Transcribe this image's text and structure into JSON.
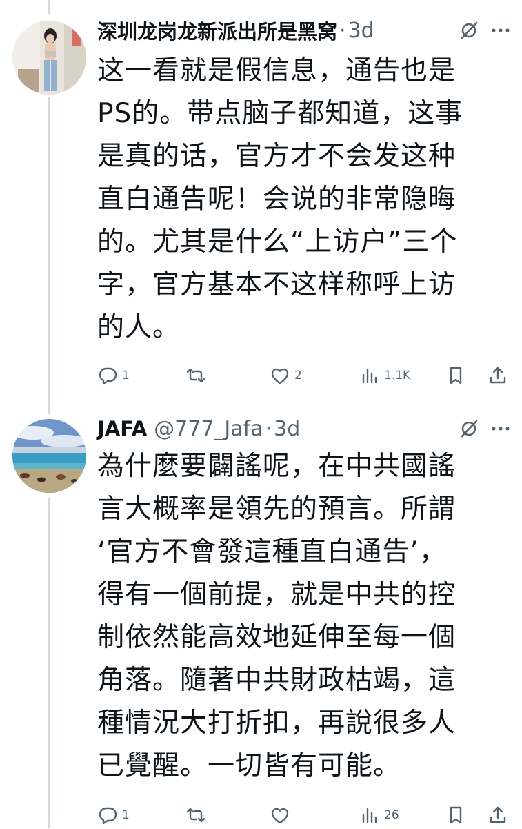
{
  "tweets": [
    {
      "name": "深圳龙岗龙新派出所是黑窝",
      "handle": "",
      "dot": "·",
      "time": "3d",
      "lines": [
        "这一看就是假信息，通告也是",
        "PS的。带点脑子都知道，这事",
        "是真的话，官方才不会发这种",
        "直白通告呢！会说的非常隐晦",
        "的。尤其是什么“上访户”三个",
        "字，官方基本不这样称呼上访",
        "的人。"
      ],
      "replies": "1",
      "retweets": "",
      "likes": "2",
      "views": "1.1K",
      "avatar": "woman-photo-avatar"
    },
    {
      "name": "JAFA",
      "handle": "@777_Jafa",
      "dot": "·",
      "time": "3d",
      "lines": [
        "為什麼要闢謠呢，在中共國謠",
        "言大概率是領先的預言。所謂",
        "‘官方不會發這種直白通告’，",
        "得有一個前提，就是中共的控",
        "制依然能高效地延伸至每一個",
        "角落。隨著中共財政枯竭，這",
        "種情況大打折扣，再說很多人",
        "已覺醒。一切皆有可能。"
      ],
      "replies": "1",
      "retweets": "",
      "likes": "",
      "views": "26",
      "avatar": "lake-landscape-avatar"
    }
  ],
  "colors": {
    "text": "#0f1419",
    "secondary": "#536471",
    "thread": "#cfd9de"
  }
}
